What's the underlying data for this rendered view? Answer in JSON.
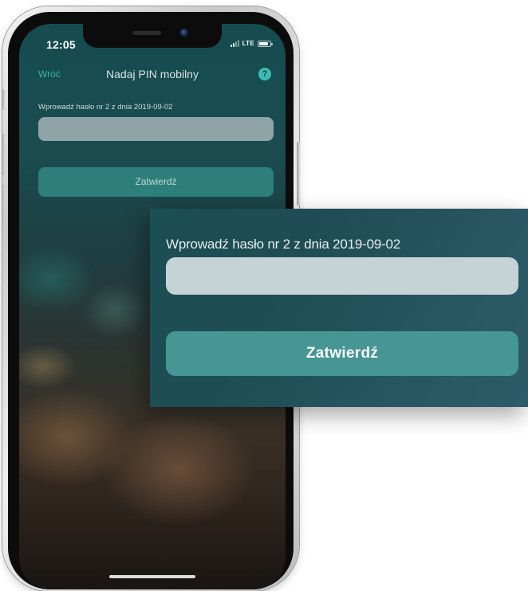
{
  "status_bar": {
    "time": "12:05",
    "network": "LTE"
  },
  "nav": {
    "back_label": "Wróć",
    "title": "Nadaj PIN mobilny",
    "help_icon": "?"
  },
  "form": {
    "password_label": "Wprowadź hasło nr 2 z dnia 2019-09-02",
    "password_value": "",
    "submit_label": "Zatwierdź"
  },
  "zoom": {
    "password_label": "Wprowadź hasło nr 2 z dnia 2019-09-02",
    "password_value": "",
    "submit_label": "Zatwierdź"
  },
  "colors": {
    "accent": "#37b3ab",
    "button": "#2e7e7b",
    "zoom_button": "#459695",
    "input": "#c5d3d6"
  }
}
